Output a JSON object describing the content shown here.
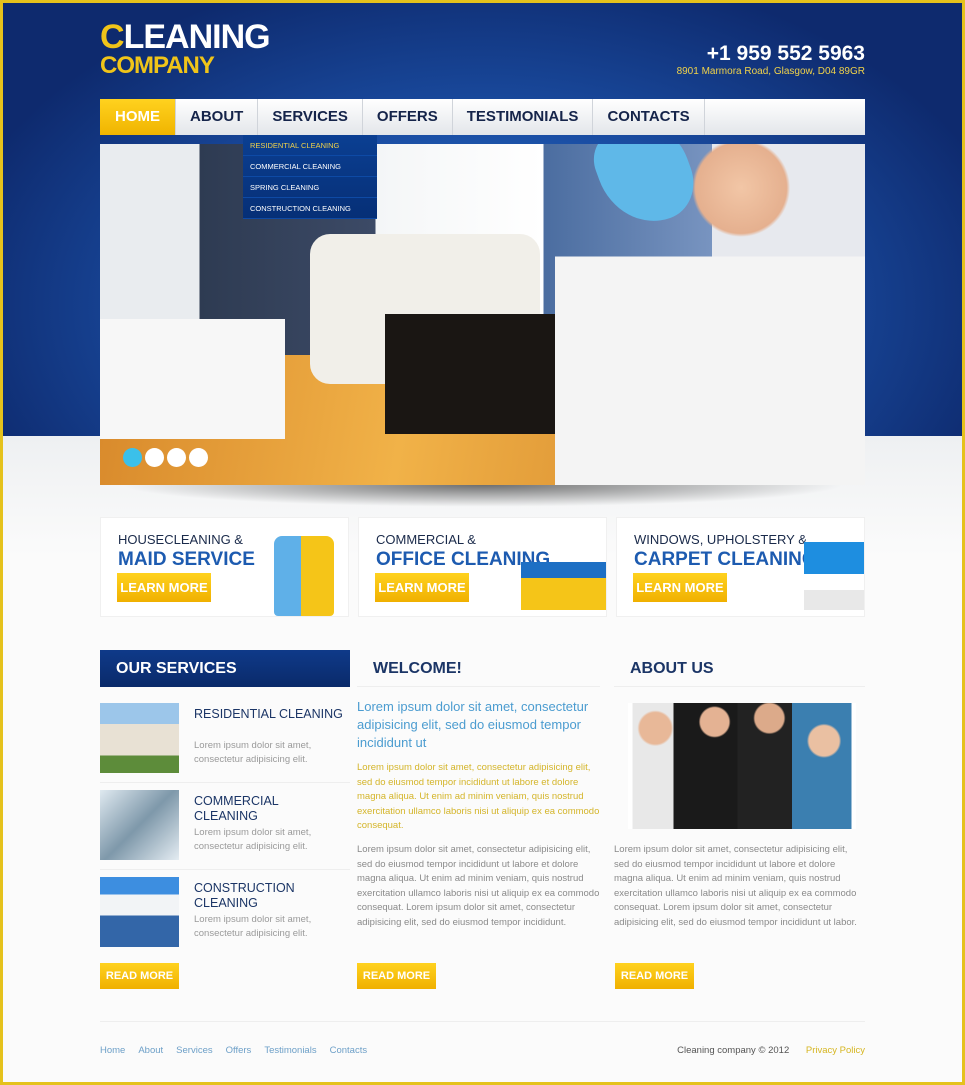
{
  "header": {
    "logo_line1_first": "C",
    "logo_line1_rest": "LEANING",
    "logo_line2": "COMPANY",
    "phone": "+1 959 552 5963",
    "address": "8901 Marmora Road, Glasgow,  D04 89GR"
  },
  "nav": {
    "items": [
      "HOME",
      "ABOUT",
      "SERVICES",
      "OFFERS",
      "TESTIMONIALS",
      "CONTACTS"
    ],
    "active": "HOME"
  },
  "dropdown": {
    "items": [
      "RESIDENTIAL CLEANING",
      "COMMERCIAL CLEANING",
      "SPRING CLEANING",
      "CONSTRUCTION CLEANING"
    ]
  },
  "slider": {
    "slide_count": 4,
    "active_slide": 1
  },
  "promos": [
    {
      "line1": "HOUSECLEANING &",
      "line2": "MAID SERVICE",
      "button": "LEARN MORE"
    },
    {
      "line1": "COMMERCIAL &",
      "line2": "OFFICE CLEANING",
      "button": "LEARN MORE"
    },
    {
      "line1": "WINDOWS, UPHOLSTERY &",
      "line2": "CARPET CLEANING",
      "button": "LEARN MORE"
    }
  ],
  "services": {
    "title": "OUR SERVICES",
    "items": [
      {
        "name": "RESIDENTIAL CLEANING",
        "desc": "Lorem ipsum dolor sit amet, consectetur adipisicing elit."
      },
      {
        "name": "COMMERCIAL CLEANING",
        "desc": "Lorem ipsum dolor sit amet, consectetur adipisicing elit."
      },
      {
        "name": "CONSTRUCTION CLEANING",
        "desc": "Lorem ipsum dolor sit amet, consectetur adipisicing elit."
      }
    ],
    "button": "READ MORE"
  },
  "welcome": {
    "title": "WELCOME!",
    "lead": "Lorem ipsum dolor sit amet, consectetur adipisicing elit, sed do eiusmod tempor incididunt ut",
    "highlight": "Lorem ipsum dolor sit amet, consectetur adipisicing elit, sed do eiusmod tempor incididunt ut labore et dolore magna aliqua. Ut enim ad minim veniam, quis nostrud exercitation ullamco laboris nisi ut aliquip ex ea commodo consequat.",
    "body": "Lorem ipsum dolor sit amet, consectetur adipisicing elit, sed do eiusmod tempor incididunt ut labore et dolore magna aliqua. Ut enim ad minim veniam, quis nostrud exercitation ullamco laboris nisi ut aliquip ex ea commodo consequat. Lorem ipsum dolor sit amet, consectetur adipisicing elit, sed do eiusmod tempor incididunt.",
    "button": "READ MORE"
  },
  "about": {
    "title": "ABOUT US",
    "body": "Lorem ipsum dolor sit amet, consectetur adipisicing elit, sed do eiusmod tempor incididunt ut labore et dolore magna aliqua. Ut enim ad minim veniam, quis nostrud exercitation ullamco laboris nisi ut aliquip ex ea commodo consequat. Lorem ipsum dolor sit amet, consectetur adipisicing elit, sed do eiusmod tempor incididunt ut labor.",
    "button": "READ MORE"
  },
  "footer": {
    "links": [
      "Home",
      "About",
      "Services",
      "Offers",
      "Testimonials",
      "Contacts"
    ],
    "copyright": "Cleaning company  © 2012",
    "privacy": "Privacy Policy"
  },
  "colors": {
    "accent": "#f0c419",
    "brand_blue": "#0f3a89",
    "border": "#e5c21c"
  }
}
